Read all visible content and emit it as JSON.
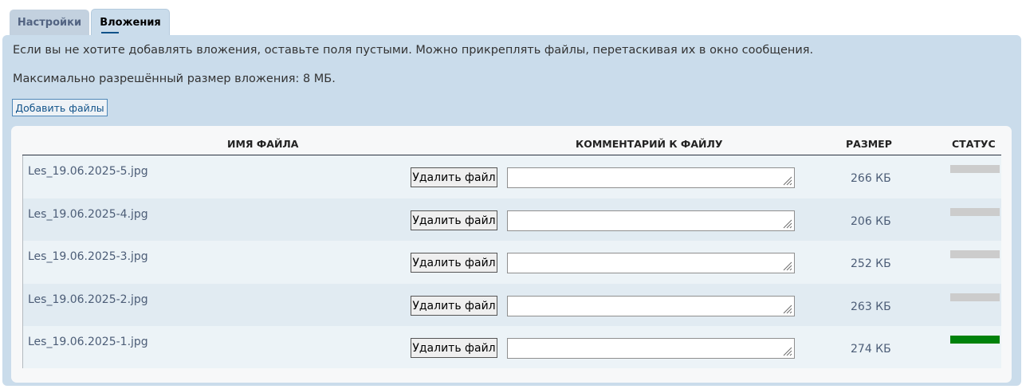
{
  "tabs": [
    {
      "label": "Настройки",
      "active": false
    },
    {
      "label": "Вложения",
      "active": true
    }
  ],
  "help": {
    "line1": "Если вы не хотите добавлять вложения, оставьте поля пустыми. Можно прикреплять файлы, перетаскивая их в окно сообщения.",
    "line2": "Максимально разрешённый размер вложения: 8 МБ."
  },
  "add_files_label": "Добавить файлы",
  "table": {
    "columns": [
      "ИМЯ ФАЙЛА",
      "КОММЕНТАРИЙ К ФАЙЛУ",
      "РАЗМЕР",
      "СТАТУС"
    ],
    "delete_label": "Удалить файл",
    "rows": [
      {
        "filename": "Les_19.06.2025-5.jpg",
        "comment": "",
        "size": "266 КБ",
        "progress": 0
      },
      {
        "filename": "Les_19.06.2025-4.jpg",
        "comment": "",
        "size": "206 КБ",
        "progress": 0
      },
      {
        "filename": "Les_19.06.2025-3.jpg",
        "comment": "",
        "size": "252 КБ",
        "progress": 0
      },
      {
        "filename": "Les_19.06.2025-2.jpg",
        "comment": "",
        "size": "263 КБ",
        "progress": 0
      },
      {
        "filename": "Les_19.06.2025-1.jpg",
        "comment": "",
        "size": "274 КБ",
        "progress": 1
      }
    ]
  },
  "colors": {
    "panel_bg": "#cadceb",
    "progress_done": "#00820b",
    "progress_pending": "#cccccc"
  },
  "icons": {
    "resize_handle": "resize-grip-icon"
  }
}
